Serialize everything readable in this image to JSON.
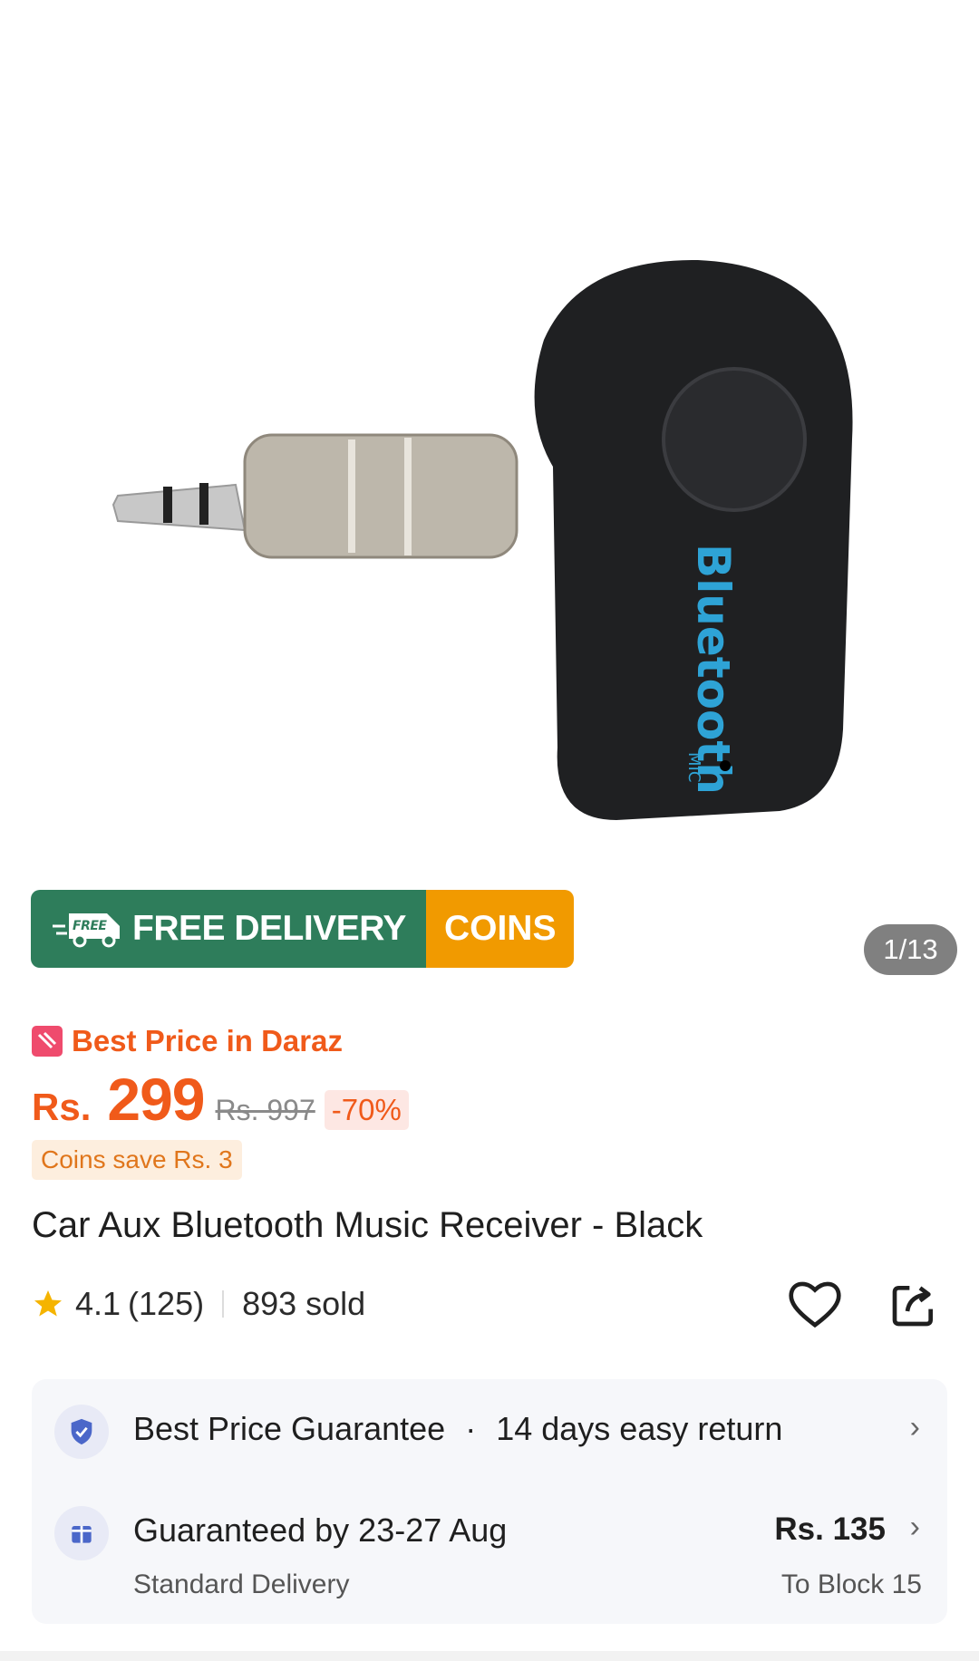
{
  "gallery": {
    "image_counter": "1/13",
    "image_text": "Bluetooth",
    "image_mic_text": "MIC"
  },
  "promo": {
    "free_icon_text": "FREE",
    "free_delivery": "FREE DELIVERY",
    "coins": "COINS"
  },
  "badge": {
    "best_price": "Best Price in Daraz"
  },
  "price": {
    "currency": "Rs.",
    "current": "299",
    "original": "Rs. 997",
    "discount": "-70%",
    "coins_save": "Coins save Rs. 3"
  },
  "product": {
    "title": "Car Aux Bluetooth Music Receiver - Black",
    "rating": "4.1",
    "reviews": "(125)",
    "sold": "893 sold"
  },
  "service": {
    "guarantee": "Best Price Guarantee",
    "separator": "·",
    "returns": "14 days easy return",
    "delivery_title": "Guaranteed by 23-27 Aug",
    "delivery_type": "Standard Delivery",
    "delivery_price": "Rs. 135",
    "delivery_to": "To Block 15"
  },
  "colors": {
    "brand_orange": "#f05a1a",
    "free_delivery_green": "#2e7d5b",
    "coins_orange": "#f19a00"
  }
}
